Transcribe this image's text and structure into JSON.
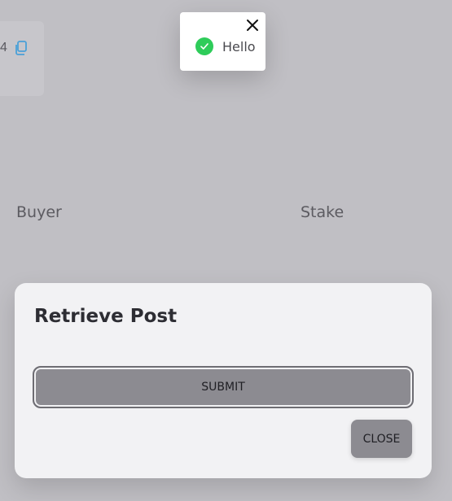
{
  "background": {
    "code_fragment": "4",
    "labels": {
      "buyer": "Buyer",
      "stake": "Stake"
    },
    "copy_icon": "copy-icon"
  },
  "toast": {
    "message": "Hello",
    "status_icon": "check-circle-icon",
    "close_icon": "close-icon",
    "status_color": "#2ecc5a"
  },
  "modal": {
    "title": "Retrieve Post",
    "submit_label": "SUBMIT",
    "close_label": "CLOSE"
  }
}
